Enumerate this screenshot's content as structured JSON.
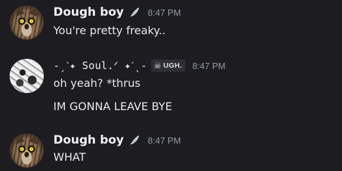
{
  "messages": [
    {
      "username": "Dough boy",
      "timestamp": "8:47 PM",
      "badge_icon": "angel-wing-icon",
      "lines": [
        "You're pretty freaky.."
      ]
    },
    {
      "username": "-ˏˋ✦ Soul.ᐟ ✦ˊˎ-",
      "timestamp": "8:47 PM",
      "tag": {
        "icon": "skull-icon",
        "text": "UGH."
      },
      "lines": [
        "oh yeah? *thrus",
        "IM GONNA LEAVE BYE"
      ]
    },
    {
      "username": "Dough boy",
      "timestamp": "8:47 PM",
      "badge_icon": "angel-wing-icon",
      "lines": [
        "WHAT"
      ]
    }
  ],
  "colors": {
    "background": "#1c1c21",
    "username": "#f2f3f5",
    "message_text": "#e9eaec",
    "timestamp": "#949ba4",
    "tag_background": "#2e2f35"
  }
}
